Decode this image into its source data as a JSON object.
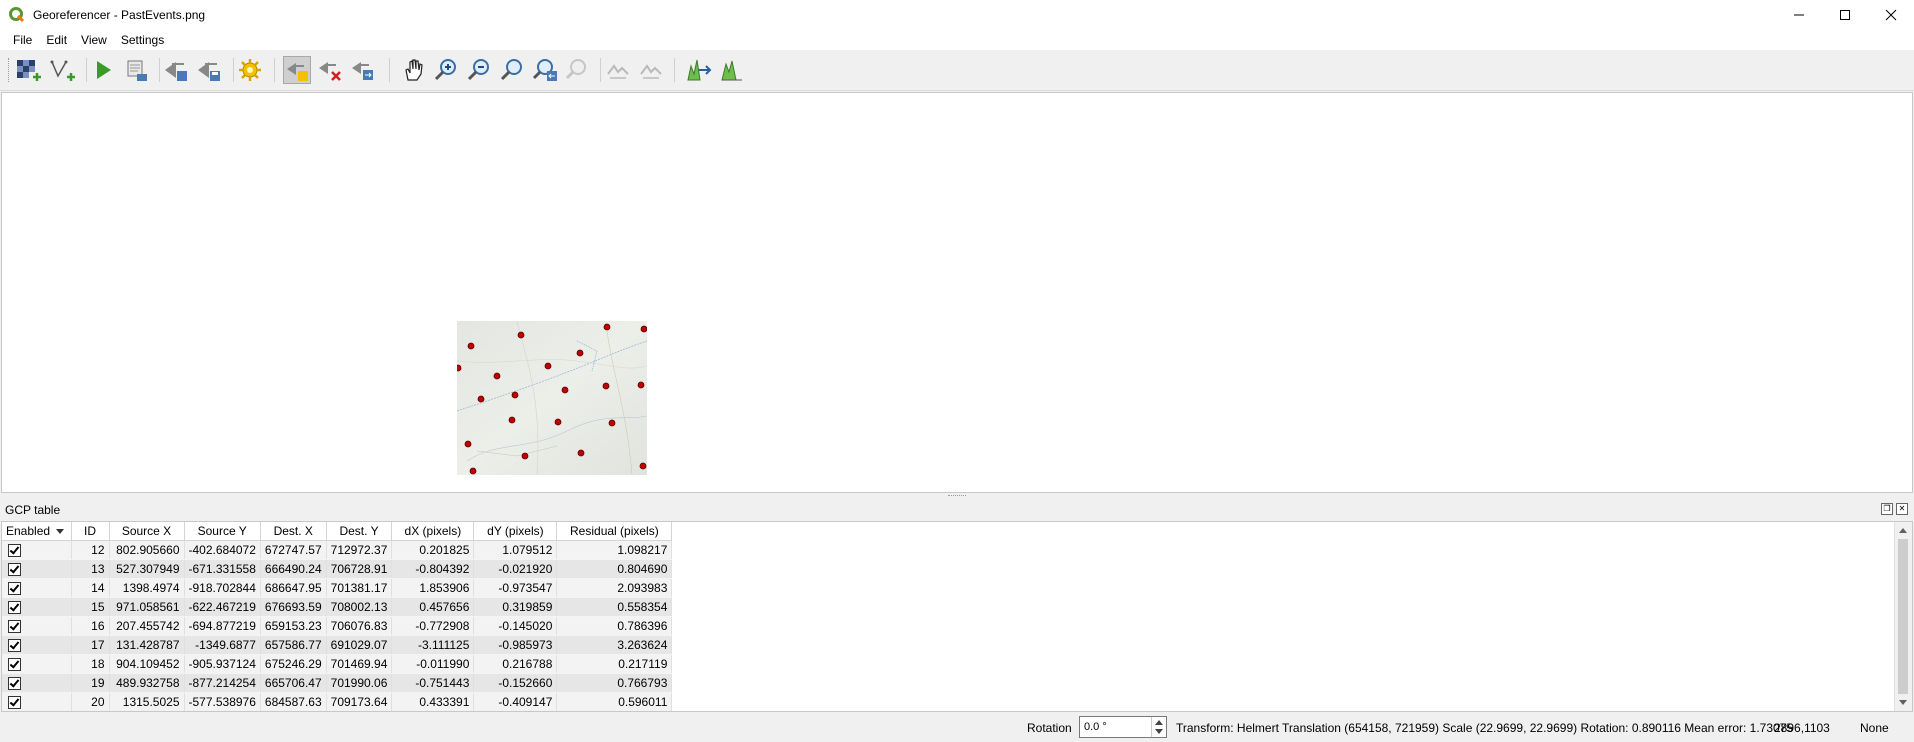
{
  "window": {
    "title": "Georeferencer - PastEvents.png",
    "controls": [
      "minimize-icon",
      "maximize-icon",
      "close-icon"
    ]
  },
  "menu": [
    "File",
    "Edit",
    "View",
    "Settings"
  ],
  "toolbar": {
    "icons": [
      "open-raster-icon",
      "start-georeferencing-icon",
      "generate-gdal-script-icon",
      "load-gcp-points-icon",
      "save-gcp-points-icon",
      "transformation-settings-icon",
      "add-point-icon",
      "delete-point-icon",
      "move-gcp-point-icon",
      "pan-icon",
      "zoom-in-icon",
      "zoom-out-icon",
      "zoom-to-layer-icon",
      "zoom-last-icon",
      "zoom-next-icon",
      "link-georeferencer-to-qgis-icon",
      "link-qgis-to-georeferencer-icon",
      "full-histogram-stretch-icon",
      "local-histogram-stretch-icon"
    ],
    "active": "add-point-icon"
  },
  "gcp_panel": {
    "title": "GCP table",
    "columns": [
      "Enabled",
      "ID",
      "Source X",
      "Source Y",
      "Dest. X",
      "Dest. Y",
      "dX (pixels)",
      "dY (pixels)",
      "Residual (pixels)"
    ],
    "rows": [
      {
        "enabled": true,
        "id": "12",
        "source_x": "802.905660",
        "source_y": "-402.684072",
        "dest_x": "672747.57",
        "dest_y": "712972.37",
        "dx": "0.201825",
        "dy": "1.079512",
        "residual": "1.098217"
      },
      {
        "enabled": true,
        "id": "13",
        "source_x": "527.307949",
        "source_y": "-671.331558",
        "dest_x": "666490.24",
        "dest_y": "706728.91",
        "dx": "-0.804392",
        "dy": "-0.021920",
        "residual": "0.804690"
      },
      {
        "enabled": true,
        "id": "14",
        "source_x": "1398.4974",
        "source_y": "-918.702844",
        "dest_x": "686647.95",
        "dest_y": "701381.17",
        "dx": "1.853906",
        "dy": "-0.973547",
        "residual": "2.093983"
      },
      {
        "enabled": true,
        "id": "15",
        "source_x": "971.058561",
        "source_y": "-622.467219",
        "dest_x": "676693.59",
        "dest_y": "708002.13",
        "dx": "0.457656",
        "dy": "0.319859",
        "residual": "0.558354"
      },
      {
        "enabled": true,
        "id": "16",
        "source_x": "207.455742",
        "source_y": "-694.877219",
        "dest_x": "659153.23",
        "dest_y": "706076.83",
        "dx": "-0.772908",
        "dy": "-0.145020",
        "residual": "0.786396"
      },
      {
        "enabled": true,
        "id": "17",
        "source_x": "131.428787",
        "source_y": "-1349.6877",
        "dest_x": "657586.77",
        "dest_y": "691029.07",
        "dx": "-3.111125",
        "dy": "-0.985973",
        "residual": "3.263624"
      },
      {
        "enabled": true,
        "id": "18",
        "source_x": "904.109452",
        "source_y": "-905.937124",
        "dest_x": "675246.29",
        "dest_y": "701469.94",
        "dx": "-0.011990",
        "dy": "0.216788",
        "residual": "0.217119"
      },
      {
        "enabled": true,
        "id": "19",
        "source_x": "489.932758",
        "source_y": "-877.214254",
        "dest_x": "665706.47",
        "dest_y": "701990.06",
        "dx": "-0.751443",
        "dy": "-0.152660",
        "residual": "0.766793"
      },
      {
        "enabled": true,
        "id": "20",
        "source_x": "1315.5025",
        "source_y": "-577.538976",
        "dest_x": "684587.63",
        "dest_y": "709173.64",
        "dx": "0.433391",
        "dy": "-0.409147",
        "residual": "0.596011"
      }
    ]
  },
  "status": {
    "rotation_label": "Rotation",
    "rotation_value": "0.0 °",
    "transform_text": "Transform: Helmert Translation (654158, 721959) Scale (22.9699, 22.9699) Rotation: 0.890116 Mean error: 1.73075",
    "coords": "2896,1103",
    "crs": "None"
  },
  "colors": {
    "gcp_point": "#c00000",
    "row_alt_light": "#f3f3f3",
    "row_alt_dark": "#e6e6e6"
  }
}
